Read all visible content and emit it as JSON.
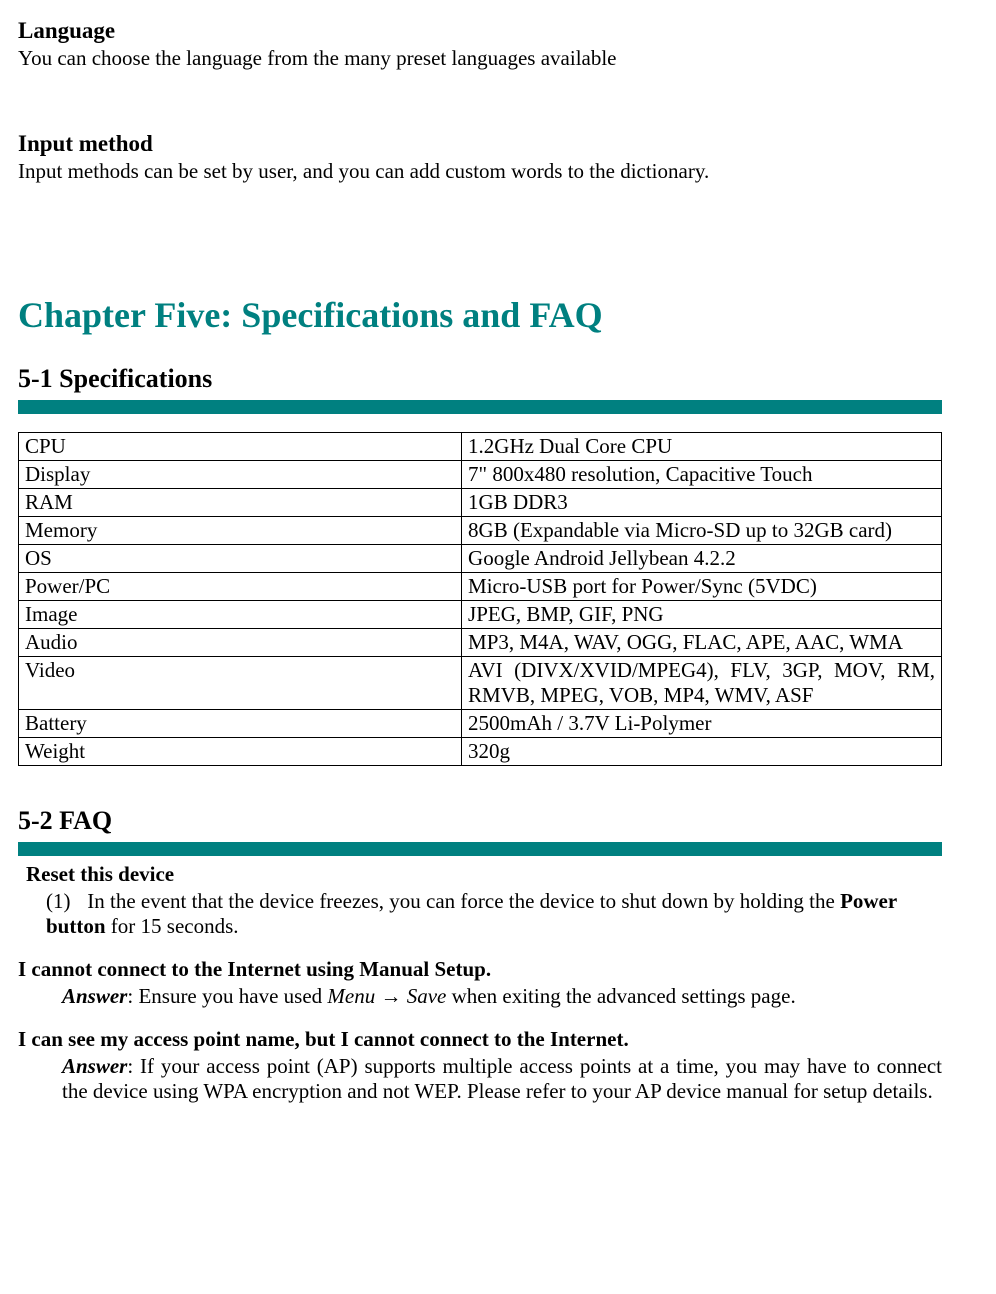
{
  "intro": {
    "lang_h": "Language",
    "lang_p": "You can choose the language from the many preset languages available",
    "im_h": "Input method",
    "im_p": "Input methods can be set by user, and you can add custom words to the dictionary."
  },
  "chapter_title": "Chapter Five: Specifications and FAQ",
  "spec_title": "5-1 Specifications",
  "faq_title": "5-2 FAQ",
  "spec_rows": [
    {
      "k": "CPU",
      "v": "1.2GHz Dual Core CPU"
    },
    {
      "k": "Display",
      "v": "7\" 800x480 resolution, Capacitive Touch"
    },
    {
      "k": "RAM",
      "v": "1GB DDR3"
    },
    {
      "k": "Memory",
      "v": "8GB (Expandable via Micro-SD up to 32GB card)"
    },
    {
      "k": "OS",
      "v": "Google Android Jellybean 4.2.2"
    },
    {
      "k": "Power/PC",
      "v": "Micro-USB port for Power/Sync (5VDC)"
    },
    {
      "k": "Image",
      "v": "JPEG, BMP, GIF, PNG"
    },
    {
      "k": "Audio",
      "v": "MP3, M4A, WAV, OGG, FLAC, APE, AAC, WMA"
    },
    {
      "k": "Video",
      "v": "AVI (DIVX/XVID/MPEG4), FLV, 3GP, MOV, RM, RMVB, MPEG, VOB, MP4, WMV, ASF"
    },
    {
      "k": "Battery",
      "v": "2500mAh / 3.7V    Li-Polymer"
    },
    {
      "k": "Weight",
      "v": "320g"
    }
  ],
  "faq": {
    "reset_h": "Reset this device",
    "reset_num": "(1)",
    "reset_pre": "In the event that the device freezes, you can force the device to shut down by holding the ",
    "reset_bold": "Power button",
    "reset_post": " for 15 seconds.",
    "q1_h": "I cannot connect to the Internet using Manual Setup.",
    "ans_label": "Answer",
    "q1_a_pre": ": Ensure you have used ",
    "q1_a_menu": "Menu ",
    "q1_a_arrow": "→",
    "q1_a_save": " Save",
    "q1_a_post": " when exiting the advanced settings page.",
    "q2_h": "I can see my access point name, but I cannot connect to the Internet.",
    "q2_a": ": If your access point (AP) supports multiple access points at a time, you may have to connect the device using WPA encryption and not WEP.  Please refer to your AP device manual for setup details."
  }
}
